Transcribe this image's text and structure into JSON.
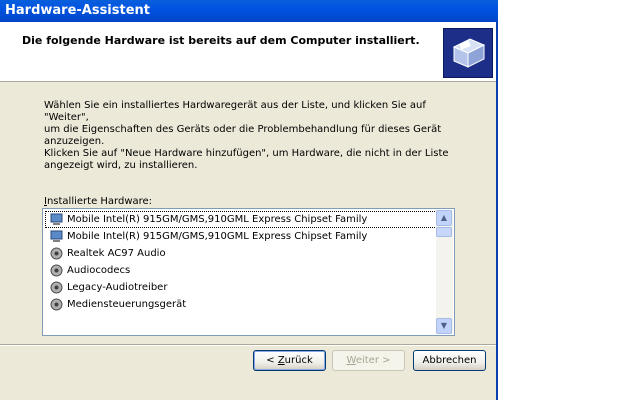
{
  "window": {
    "title": "Hardware-Assistent"
  },
  "header": {
    "title": "Die folgende Hardware ist bereits auf dem Computer installiert.",
    "icon": "hardware-wizard-icon"
  },
  "body": {
    "paragraph1_line1": "Wählen Sie ein installiertes Hardwaregerät aus der Liste, und klicken Sie auf \"Weiter\",",
    "paragraph1_line2": "um die Eigenschaften des Geräts oder die Problembehandlung für dieses Gerät",
    "paragraph1_line3": "anzuzeigen.",
    "paragraph2_line1": "Klicken Sie auf \"Neue Hardware hinzufügen\", um Hardware, die nicht in der Liste",
    "paragraph2_line2": "angezeigt wird, zu installieren."
  },
  "list": {
    "label_accel": "I",
    "label_rest": "nstallierte Hardware:",
    "items": [
      {
        "label": "Mobile Intel(R) 915GM/GMS,910GML Express Chipset Family",
        "icon": "display-adapter-icon"
      },
      {
        "label": "Mobile Intel(R) 915GM/GMS,910GML Express Chipset Family",
        "icon": "display-adapter-icon"
      },
      {
        "label": "Realtek AC97 Audio",
        "icon": "audio-device-icon"
      },
      {
        "label": "Audiocodecs",
        "icon": "audio-device-icon"
      },
      {
        "label": "Legacy-Audiotreiber",
        "icon": "audio-device-icon"
      },
      {
        "label": "Mediensteuerungsgerät",
        "icon": "audio-device-icon"
      }
    ]
  },
  "buttons": {
    "back_prefix": "< ",
    "back_accel": "Z",
    "back_rest": "urück",
    "next_accel": "W",
    "next_rest": "eiter >",
    "cancel": "Abbrechen"
  },
  "colors": {
    "titlebar": "#0054e3",
    "dialog_bg": "#ece9d8",
    "accent_border": "#003c74"
  }
}
